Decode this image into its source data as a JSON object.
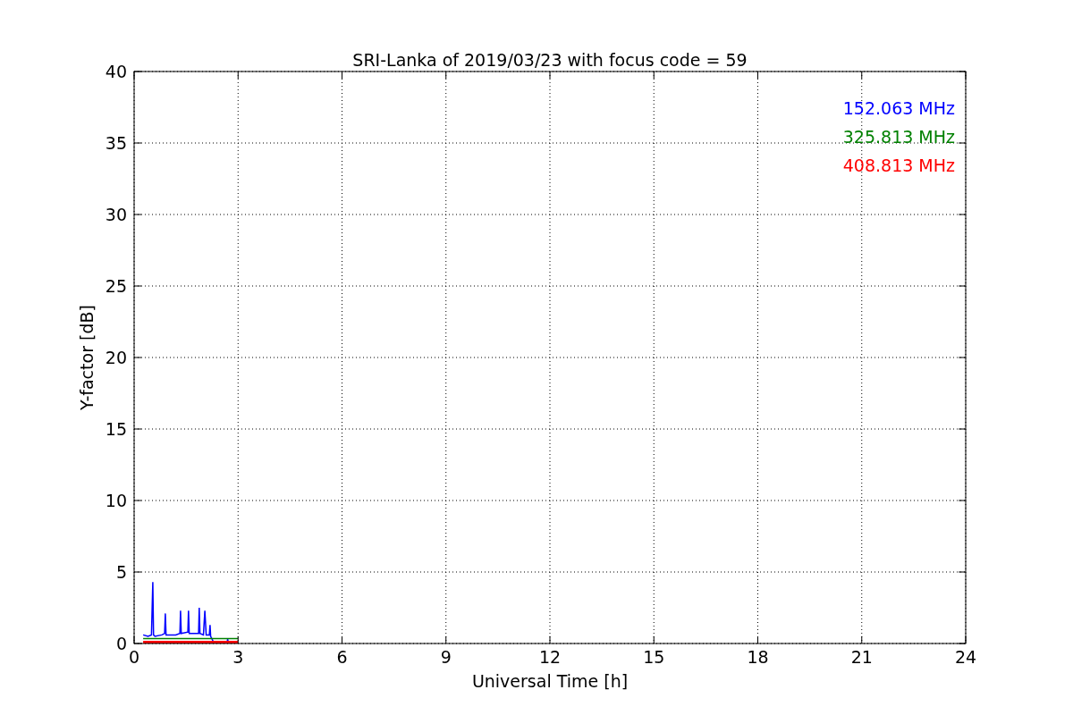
{
  "chart_data": {
    "type": "line",
    "title": "SRI-Lanka of 2019/03/23 with focus code = 59",
    "xlabel": "Universal Time [h]",
    "ylabel": "Y-factor [dB]",
    "x": [
      0.26,
      0.4,
      0.5,
      0.52,
      0.54,
      0.56,
      0.6,
      0.8,
      0.88,
      0.9,
      0.92,
      1.2,
      1.32,
      1.34,
      1.36,
      1.55,
      1.57,
      1.59,
      1.86,
      1.88,
      1.9,
      2.0,
      2.04,
      2.08,
      2.17,
      2.19,
      2.21,
      2.25,
      2.3,
      2.68,
      2.7,
      2.72,
      3.0
    ],
    "series": [
      {
        "name": "152.063 MHz",
        "color": "#0000ff",
        "values": [
          0.6,
          0.5,
          0.6,
          2.6,
          4.3,
          0.6,
          0.5,
          0.6,
          0.7,
          2.1,
          0.6,
          0.6,
          0.7,
          2.3,
          0.7,
          0.8,
          2.3,
          0.7,
          0.7,
          2.5,
          0.7,
          0.6,
          2.3,
          0.6,
          0.6,
          1.3,
          0.5,
          0.3,
          0.05,
          0.05,
          0.3,
          0.05,
          null
        ]
      },
      {
        "name": "325.813 MHz",
        "color": "#008000",
        "values": [
          0.35,
          0.35,
          0.35,
          0.35,
          0.35,
          0.35,
          0.35,
          0.35,
          0.35,
          0.35,
          0.35,
          0.35,
          0.35,
          0.35,
          0.35,
          0.35,
          0.35,
          0.35,
          0.35,
          0.35,
          0.35,
          0.35,
          0.35,
          0.35,
          0.35,
          0.35,
          0.35,
          0.35,
          0.35,
          0.35,
          0.35,
          0.35,
          0.35
        ]
      },
      {
        "name": "408.813 MHz",
        "color": "#ff0000",
        "values": [
          0.1,
          0.1,
          0.1,
          0.1,
          0.1,
          0.1,
          0.1,
          0.1,
          0.1,
          0.1,
          0.1,
          0.1,
          0.1,
          0.1,
          0.1,
          0.1,
          0.1,
          0.1,
          0.1,
          0.1,
          0.1,
          0.1,
          0.1,
          0.1,
          0.1,
          0.1,
          0.1,
          0.1,
          0.1,
          0.1,
          0.1,
          0.1,
          0.1
        ]
      }
    ],
    "grid": true,
    "xlim": [
      0,
      24
    ],
    "ylim": [
      0,
      40
    ],
    "xticks": [
      0,
      3,
      6,
      9,
      12,
      15,
      18,
      21,
      24
    ],
    "yticks": [
      0,
      5,
      10,
      15,
      20,
      25,
      30,
      35,
      40
    ]
  }
}
